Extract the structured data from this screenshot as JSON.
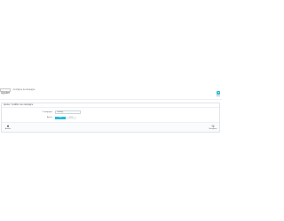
{
  "breadcrumb": {
    "home_label": "",
    "separator": "›",
    "current": "Configure la campagne"
  },
  "page": {
    "title": "Ajouter"
  },
  "header_actions": {
    "help_icon": "help-icon",
    "help_label": "Aide"
  },
  "panel": {
    "heading": "Ajouter / modifier une campagne",
    "fields": {
      "name_label": "* Campagne",
      "name_value": "Catalog",
      "active_label": "Active",
      "switch_yes": "OUI",
      "switch_no": "NON"
    },
    "footer": {
      "cancel_label": "Annuler",
      "save_label": "Enregistrer"
    }
  },
  "colors": {
    "accent": "#25b9d7",
    "border": "#dfe4e7",
    "text": "#555555"
  }
}
